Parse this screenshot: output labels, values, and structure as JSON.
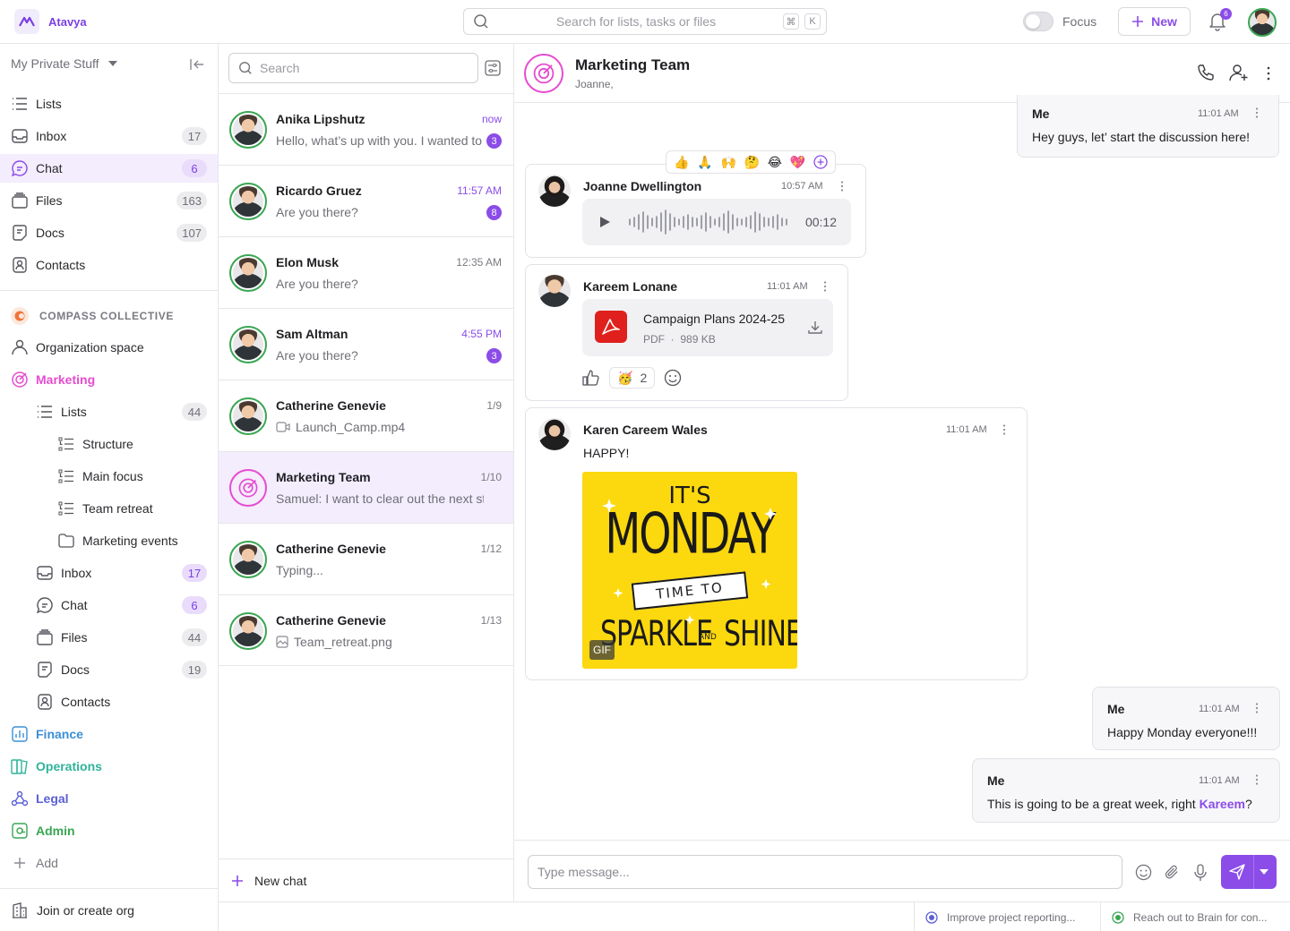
{
  "brand": {
    "name": "Atavya"
  },
  "search": {
    "placeholder": "Search for lists, tasks or files",
    "k1": "⌘",
    "k2": "K"
  },
  "focus_label": "Focus",
  "new_label": "New",
  "notifications": {
    "count": "6"
  },
  "sidebar": {
    "workspace": "My Private Stuff",
    "items": [
      {
        "label": "Lists",
        "count": ""
      },
      {
        "label": "Inbox",
        "count": "17"
      },
      {
        "label": "Chat",
        "count": "6"
      },
      {
        "label": "Files",
        "count": "163"
      },
      {
        "label": "Docs",
        "count": "107"
      },
      {
        "label": "Contacts",
        "count": ""
      }
    ],
    "org_title": "COMPASS COLLECTIVE",
    "org_items": [
      {
        "label": "Organization space"
      },
      {
        "label": "Marketing"
      },
      {
        "label": "Lists",
        "count": "44"
      },
      {
        "label": "Structure"
      },
      {
        "label": "Main focus"
      },
      {
        "label": "Team retreat"
      },
      {
        "label": "Marketing events"
      },
      {
        "label": "Inbox",
        "count": "17"
      },
      {
        "label": "Chat",
        "count": "6"
      },
      {
        "label": "Files",
        "count": "44"
      },
      {
        "label": "Docs",
        "count": "19"
      },
      {
        "label": "Contacts"
      },
      {
        "label": "Finance"
      },
      {
        "label": "Operations"
      },
      {
        "label": "Legal"
      },
      {
        "label": "Admin"
      },
      {
        "label": "Add"
      }
    ],
    "join_label": "Join or create org"
  },
  "chatlist": {
    "search_placeholder": "Search",
    "items": [
      {
        "name": "Anika Lipshutz",
        "time": "now",
        "preview": "Hello, what’s up with you. I wanted to ask",
        "badge": "3"
      },
      {
        "name": "Ricardo Gruez",
        "time": "11:57 AM",
        "preview": "Are you there?",
        "badge": "8"
      },
      {
        "name": "Elon Musk",
        "time": "12:35 AM",
        "preview": "Are you there?",
        "badge": ""
      },
      {
        "name": "Sam Altman",
        "time": "4:55 PM",
        "preview": "Are you there?",
        "badge": "3"
      },
      {
        "name": "Catherine Genevie",
        "time": "1/9",
        "preview": "Launch_Camp.mp4",
        "badge": ""
      },
      {
        "name": "Marketing Team",
        "time": "1/10",
        "preview": "Samuel: I want to clear out the next steps",
        "badge": ""
      },
      {
        "name": "Catherine Genevie",
        "time": "1/12",
        "preview": "Typing...",
        "badge": ""
      },
      {
        "name": "Catherine Genevie",
        "time": "1/13",
        "preview": "Team_retreat.png",
        "badge": ""
      }
    ],
    "new_chat_label": "New chat"
  },
  "conversation": {
    "title": "Marketing Team",
    "subtitle": "Joanne,",
    "reactions_bar": [
      "👍",
      "🙏",
      "🙌",
      "🤔",
      "😂",
      "💖"
    ],
    "messages": [
      {
        "sender": "Me",
        "time": "11:01 AM",
        "text": "Hey guys, let’ start the discussion here!"
      },
      {
        "sender": "Joanne Dwellington",
        "time": "10:57 AM",
        "voice_duration": "00:12"
      },
      {
        "sender": "Kareem Lonane",
        "time": "11:01 AM",
        "file_name": "Campaign Plans 2024-25",
        "file_type": "PDF",
        "file_size": "989 KB",
        "reaction_emoji": "🥳",
        "reaction_count": "2"
      },
      {
        "sender": "Karen Careem Wales",
        "time": "11:01 AM",
        "text": "HAPPY!",
        "gif_tag": "GIF",
        "gif_text": [
          "IT'S",
          "MONDAY",
          "TIME TO",
          "SPARKLE",
          "AND",
          "SHINE"
        ]
      },
      {
        "sender": "Me",
        "time": "11:01 AM",
        "text": "Happy Monday everyone!!!"
      },
      {
        "sender": "Me",
        "time": "11:01 AM",
        "text": "This is going to be a great week, right ",
        "mention": "Kareem",
        "text_end": "?"
      }
    ]
  },
  "composer": {
    "placeholder": "Type message..."
  },
  "footer": {
    "tasks": [
      "Improve project reporting...",
      "Reach out to Brain for con..."
    ]
  },
  "colors": {
    "accent": "#8b4ce8",
    "online": "#3aa653",
    "team": "#e64ccf",
    "pdf": "#e0201c",
    "gif_bg": "#fcd80e"
  }
}
